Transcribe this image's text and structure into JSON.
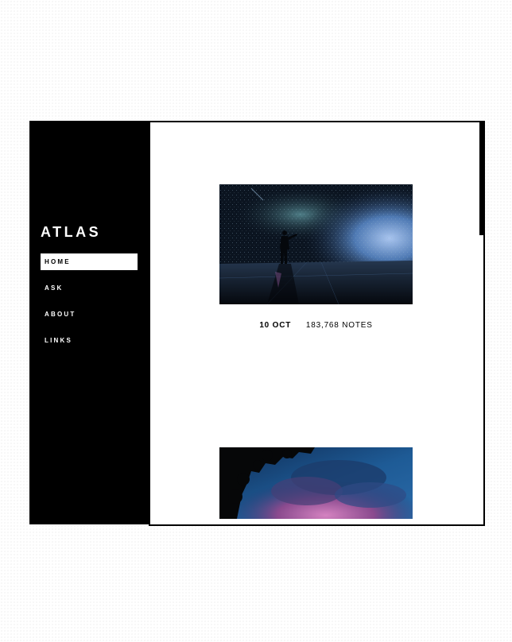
{
  "sidebar": {
    "title": "ATLAS",
    "nav": [
      {
        "label": "HOME",
        "active": true
      },
      {
        "label": "ASK",
        "active": false
      },
      {
        "label": "ABOUT",
        "active": false
      },
      {
        "label": "LINKS",
        "active": false
      }
    ]
  },
  "posts": [
    {
      "type": "photo",
      "image": "rain-room-silhouette-photo",
      "date": "10 OCT",
      "notes": "183,768 NOTES"
    },
    {
      "type": "photo",
      "image": "storm-clouds-photo"
    }
  ],
  "colors": {
    "background": "#ffffff",
    "sidebar": "#000000",
    "text_on_dark": "#ffffff",
    "accent": "#000000"
  }
}
